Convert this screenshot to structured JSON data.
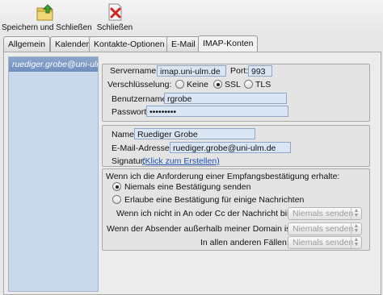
{
  "toolbar": {
    "save_close_label": "Speichern und Schließen",
    "close_label": "Schließen"
  },
  "tabs": [
    {
      "label": "Allgemein"
    },
    {
      "label": "Kalender"
    },
    {
      "label": "Kontakte-Optionen"
    },
    {
      "label": "E-Mail"
    },
    {
      "label": "IMAP-Konten"
    }
  ],
  "active_tab": "IMAP-Konten",
  "sidebar": {
    "accounts": [
      {
        "label": "ruediger.grobe@uni-ulm.de"
      }
    ]
  },
  "server": {
    "servername_label": "Servername:",
    "servername_value": "imap.uni-ulm.de",
    "port_label": "Port:",
    "port_value": "993",
    "encryption_label": "Verschlüsselung:",
    "encryption_options": [
      {
        "label": "Keine",
        "selected": false
      },
      {
        "label": "SSL",
        "selected": true
      },
      {
        "label": "TLS",
        "selected": false
      }
    ],
    "username_label": "Benutzername:",
    "username_value": "rgrobe",
    "password_label": "Passwort:",
    "password_value": "•••••••••"
  },
  "identity": {
    "name_label": "Name:",
    "name_value": "Ruediger Grobe",
    "email_label": "E-Mail-Adresse:",
    "email_value": "ruediger.grobe@uni-ulm.de",
    "signature_label": "Signatur:",
    "signature_link": "(Klick zum Erstellen)"
  },
  "receipts": {
    "intro": "Wenn ich die Anforderung einer Empfangsbestätigung erhalte:",
    "options": [
      {
        "label": "Niemals eine Bestätigung senden",
        "selected": true
      },
      {
        "label": "Erlaube eine Bestätigung für einige Nachrichten",
        "selected": false
      }
    ],
    "rules": [
      {
        "label": "Wenn ich nicht in An oder Cc der Nachricht bin:",
        "value": "Niemals senden"
      },
      {
        "label": "Wenn der Absender außerhalb meiner Domain ist:",
        "value": "Niemals senden"
      },
      {
        "label": "In allen anderen Fällen:",
        "value": "Niemals senden"
      }
    ]
  },
  "colors": {
    "field_bg": "#dbe6f5",
    "sidebar_bg": "#c9d8ea",
    "selection": "#7594c4",
    "link": "#1a4fb5"
  }
}
